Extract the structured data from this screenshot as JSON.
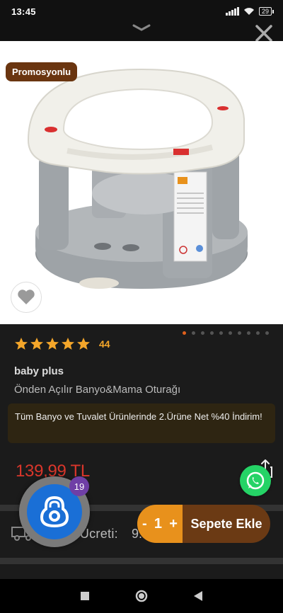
{
  "status_bar": {
    "time": "13:45",
    "battery": "29"
  },
  "product": {
    "promo_badge": "Promosyonlu",
    "rating_count": "44",
    "brand": "baby plus",
    "name": "Önden Açılır Banyo&Mama Oturağı",
    "promotion_text": "Tüm Banyo ve Tuvalet Ürünlerinde 2.Ürüne Net %40 İndirim!",
    "price": "139,99 TL",
    "rating_stars": 5
  },
  "carousel": {
    "total_slides": 10,
    "active_index": 0
  },
  "shipping": {
    "label": "Kargo Ücreti:",
    "value": "9."
  },
  "floating_widget": {
    "badge": "19"
  },
  "cart": {
    "minus": "-",
    "quantity": "1",
    "plus": "+",
    "add_label": "Sepete Ekle"
  },
  "colors": {
    "accent": "#e8911c",
    "price": "#d9362b",
    "rating": "#f4a62a",
    "promo_badge": "#6a3510",
    "whatsapp": "#25d366"
  }
}
